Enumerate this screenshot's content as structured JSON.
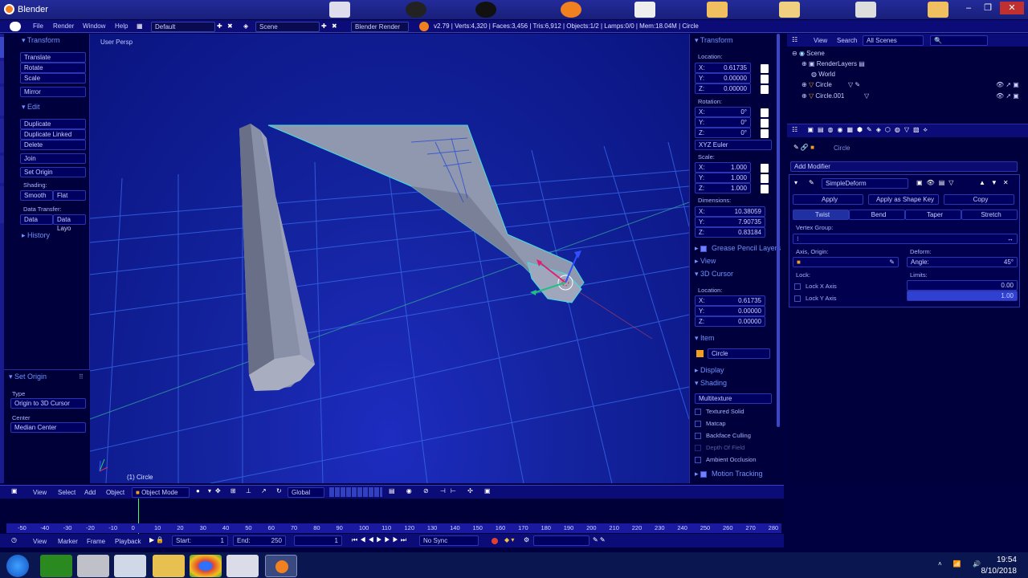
{
  "window": {
    "title": "Blender"
  },
  "infobar": {
    "menus": [
      "File",
      "Render",
      "Window",
      "Help"
    ],
    "layout": "Default",
    "scene": "Scene",
    "engine": "Blender Render",
    "stats": "v2.79 | Verts:4,320 | Faces:3,456 | Tris:6,912 | Objects:1/2 | Lamps:0/0 | Mem:18.04M | Circle"
  },
  "toolshelf": {
    "tabs": [
      "Tools",
      "Create",
      "Relations",
      "Animation",
      "Physics",
      "Grease Pencil"
    ],
    "transform_header": "Transform",
    "transform": [
      "Translate",
      "Rotate",
      "Scale"
    ],
    "mirror": "Mirror",
    "edit_header": "Edit",
    "edit": [
      "Duplicate",
      "Duplicate Linked",
      "Delete"
    ],
    "join": "Join",
    "set_origin": "Set Origin",
    "shading_label": "Shading:",
    "smooth": "Smooth",
    "flat": "Flat",
    "data_transfer_label": "Data Transfer:",
    "data": "Data",
    "data_layo": "Data Layo",
    "history": "History",
    "operator": {
      "header": "Set Origin",
      "type_label": "Type",
      "type_value": "Origin to 3D Cursor",
      "center_label": "Center",
      "center_value": "Median Center"
    }
  },
  "viewport": {
    "label": "User Persp",
    "object": "(1) Circle"
  },
  "npanel": {
    "transform": "Transform",
    "location": "Location:",
    "loc": [
      "0.61735",
      "0.00000",
      "0.00000"
    ],
    "rotation": "Rotation:",
    "rot": [
      "0°",
      "0°",
      "0°"
    ],
    "euler": "XYZ Euler",
    "scale": "Scale:",
    "scl": [
      "1.000",
      "1.000",
      "1.000"
    ],
    "dimensions": "Dimensions:",
    "dim": [
      "10.38059",
      "7.90735",
      "0.83184"
    ],
    "grease": "Grease Pencil Layers",
    "view": "View",
    "cursor": "3D Cursor",
    "cursor_location": "Location:",
    "cur": [
      "0.61735",
      "0.00000",
      "0.00000"
    ],
    "item": "Item",
    "item_name": "Circle",
    "display": "Display",
    "shading": "Shading",
    "matcap_mode": "Multitexture",
    "shading_opts": [
      "Textured Solid",
      "Matcap",
      "Backface Culling",
      "Depth Of Field",
      "Ambient Occlusion"
    ],
    "motion": "Motion Tracking",
    "axes": [
      "X:",
      "Y:",
      "Z:"
    ]
  },
  "outliner": {
    "view": "View",
    "search": "Search",
    "filter": "All Scenes",
    "tree": [
      "Scene",
      "RenderLayers",
      "World",
      "Circle",
      "Circle.001"
    ]
  },
  "properties": {
    "object": "Circle",
    "add_modifier": "Add Modifier",
    "modifier_name": "SimpleDeform",
    "apply": "Apply",
    "apply_shape": "Apply as Shape Key",
    "copy": "Copy",
    "modes": [
      "Twist",
      "Bend",
      "Taper",
      "Stretch"
    ],
    "vertex_group": "Vertex Group:",
    "axis_origin": "Axis, Origin:",
    "deform": "Deform:",
    "angle_label": "Angle:",
    "angle_value": "45°",
    "lock": "Lock:",
    "limits": "Limits:",
    "lock_x": "Lock X Axis",
    "lock_y": "Lock Y Axis",
    "limit_min": "0.00",
    "limit_max": "1.00"
  },
  "vheader": {
    "menus": [
      "View",
      "Select",
      "Add",
      "Object"
    ],
    "mode": "Object Mode",
    "orientation": "Global"
  },
  "timeline": {
    "ticks": [
      "-50",
      "-40",
      "-30",
      "-20",
      "-10",
      "0",
      "10",
      "20",
      "30",
      "40",
      "50",
      "60",
      "70",
      "80",
      "90",
      "100",
      "110",
      "120",
      "130",
      "140",
      "150",
      "160",
      "170",
      "180",
      "190",
      "200",
      "210",
      "220",
      "230",
      "240",
      "250",
      "260",
      "270",
      "280"
    ],
    "menus": [
      "View",
      "Marker",
      "Frame",
      "Playback"
    ],
    "start_label": "Start:",
    "start": "1",
    "end_label": "End:",
    "end": "250",
    "current": "1",
    "sync": "No Sync"
  },
  "taskbar": {
    "time": "19:54",
    "date": "8/10/2018"
  },
  "colors": {
    "panel": "#00003c",
    "accent": "#7090ff",
    "header": "#0c0c78"
  }
}
